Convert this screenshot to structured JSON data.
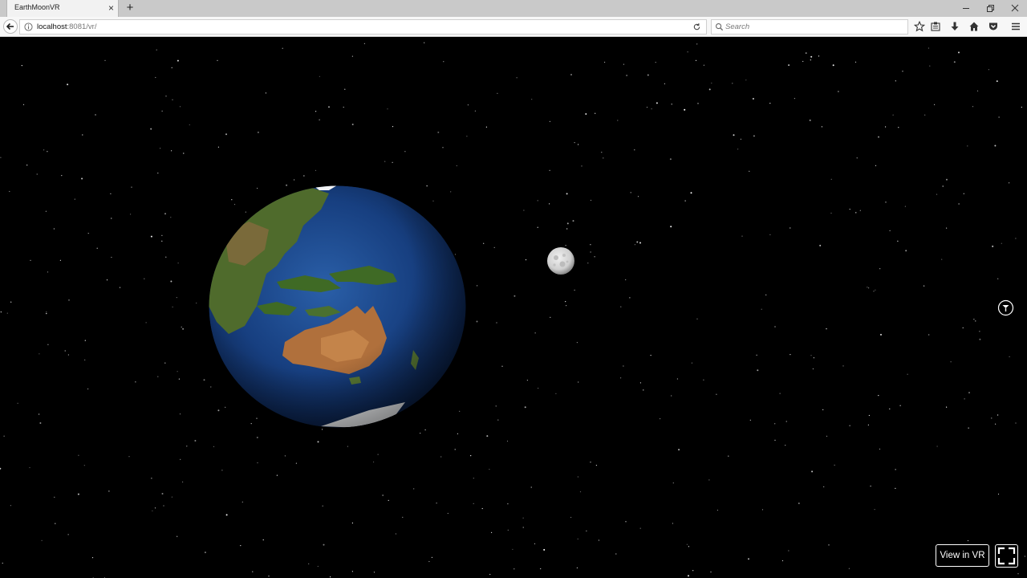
{
  "browser": {
    "tab_title": "EarthMoonVR",
    "tab_close": "×",
    "new_tab": "+",
    "url_host": "localhost",
    "url_rest": ":8081/vr/",
    "search_placeholder": "Search"
  },
  "scene": {
    "background": "#000000",
    "earth_ocean_color": "#1d4f96",
    "moon_color": "#d4d4d4",
    "star_color": "#ffffff"
  },
  "vr_controls": {
    "view_in_vr_label": "View in VR",
    "fullscreen_icon": "fullscreen-icon"
  }
}
